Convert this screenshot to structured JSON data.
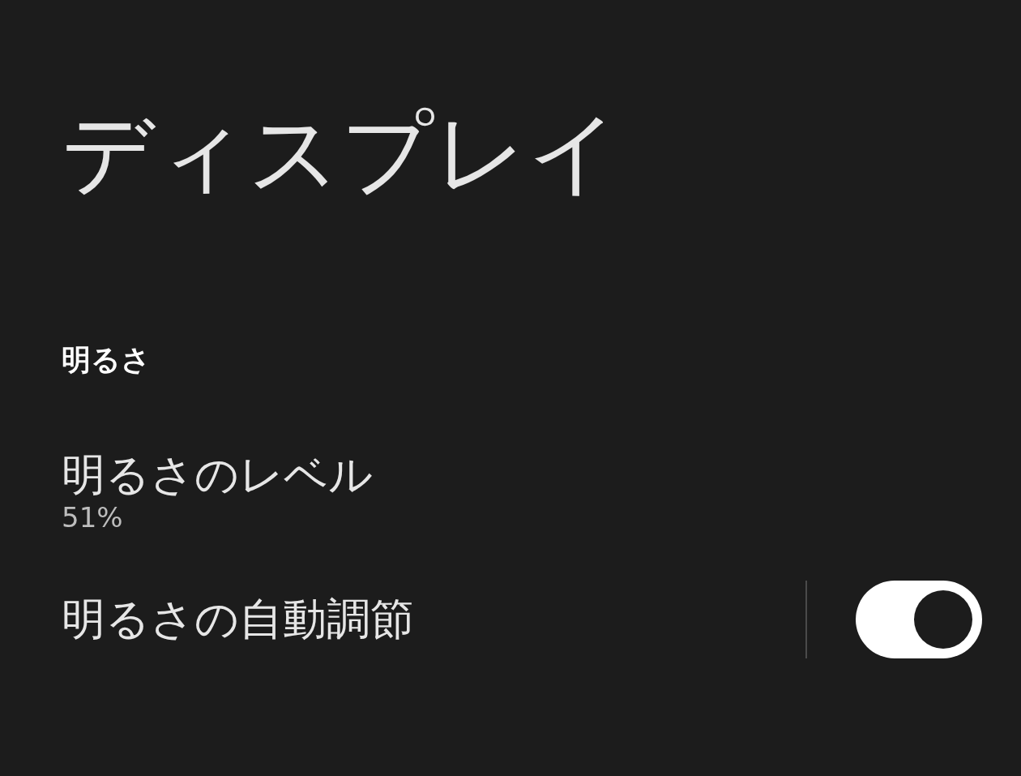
{
  "title": "ディスプレイ",
  "section": {
    "header": "明るさ",
    "items": [
      {
        "kind": "info",
        "title": "明るさのレベル",
        "summary": "51%"
      },
      {
        "kind": "toggle",
        "title": "明るさの自動調節",
        "on": true
      }
    ]
  }
}
